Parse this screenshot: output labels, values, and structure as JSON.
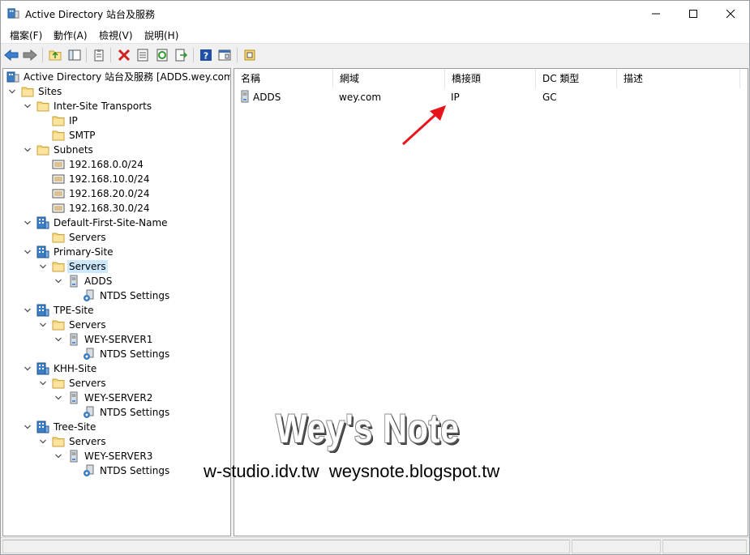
{
  "window": {
    "title": "Active Directory 站台及服務"
  },
  "menu": [
    "檔案(F)",
    "動作(A)",
    "檢視(V)",
    "說明(H)"
  ],
  "toolbar": {
    "icons": [
      "back-icon",
      "forward-icon",
      "up-folder-icon",
      "show-hide-tree-icon",
      "clipboard-icon",
      "delete-icon",
      "properties-icon",
      "refresh-icon",
      "export-list-icon",
      "help-icon",
      "console-view-icon",
      "new-object-icon"
    ]
  },
  "tree": {
    "root": "Active Directory 站台及服務 [ADDS.wey.com]",
    "sites": "Sites",
    "inter_site_transports": "Inter-Site Transports",
    "ip": "IP",
    "smtp": "SMTP",
    "subnets": "Subnets",
    "subnet_list": [
      "192.168.0.0/24",
      "192.168.10.0/24",
      "192.168.20.0/24",
      "192.168.30.0/24"
    ],
    "default_site": "Default-First-Site-Name",
    "primary_site": "Primary-Site",
    "tpe_site": "TPE-Site",
    "khh_site": "KHH-Site",
    "tree_site": "Tree-Site",
    "servers": "Servers",
    "server_adds": "ADDS",
    "server_wey1": "WEY-SERVER1",
    "server_wey2": "WEY-SERVER2",
    "server_wey3": "WEY-SERVER3",
    "ntds": "NTDS Settings",
    "selected": "Servers (Primary-Site)"
  },
  "list": {
    "columns": [
      "名稱",
      "網域",
      "橋接頭",
      "DC 類型",
      "描述"
    ],
    "rows": [
      {
        "name": "ADDS",
        "domain": "wey.com",
        "bridgehead": "IP",
        "dc_type": "GC",
        "description": ""
      }
    ]
  },
  "watermark": {
    "title": "Wey's Note",
    "urls": "w-studio.idv.tw  weysnote.blogspot.tw"
  },
  "annotation": {
    "arrow_color": "#e8141c"
  }
}
